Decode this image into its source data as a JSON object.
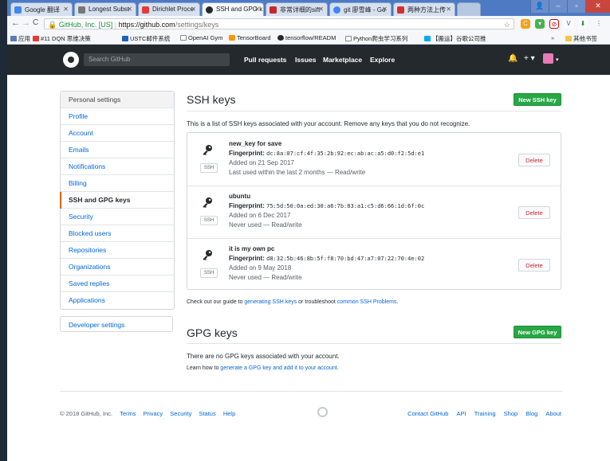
{
  "browser": {
    "tabs": [
      {
        "label": "Google 翻译",
        "color": "#4285f4"
      },
      {
        "label": "Longest Subst",
        "color": "#777777"
      },
      {
        "label": "Dirichlet Proce",
        "color": "#e53935"
      },
      {
        "label": "SSH and GPG k",
        "color": "#24292e",
        "active": true
      },
      {
        "label": "非常详细的sift",
        "color": "#c62828"
      },
      {
        "label": "git 廖雪峰 - Go",
        "color": "#4285f4"
      },
      {
        "label": "两种方法上传",
        "color": "#d32f2f"
      }
    ],
    "address": {
      "secure_label": "GitHub, Inc. [US]",
      "url_host": "https://github.com",
      "url_path": "/settings/keys"
    },
    "bookmarks": [
      {
        "label": "应用",
        "color": "#5b7ab8"
      },
      {
        "label": "#11 DQN 思维决策",
        "color": "#e53935"
      },
      {
        "label": "USTC邮件系统",
        "color": "#1565c0"
      },
      {
        "label": "OpenAI Gym",
        "color": "#888888"
      },
      {
        "label": "TensorBoard",
        "color": "#ff9800"
      },
      {
        "label": "tensorflow/READM",
        "color": "#24292e"
      },
      {
        "label": "Python爬虫学习系列",
        "color": "#888888"
      },
      {
        "label": "【搬运】谷歌公司推",
        "color": "#03a9f4"
      }
    ],
    "other_bookmarks": "其他书签"
  },
  "header": {
    "search_placeholder": "Search GitHub",
    "nav": [
      "Pull requests",
      "Issues",
      "Marketplace",
      "Explore"
    ]
  },
  "sidebar": {
    "heading": "Personal settings",
    "items": [
      "Profile",
      "Account",
      "Emails",
      "Notifications",
      "Billing",
      "SSH and GPG keys",
      "Security",
      "Blocked users",
      "Repositories",
      "Organizations",
      "Saved replies",
      "Applications"
    ],
    "selected": "SSH and GPG keys",
    "developer": "Developer settings"
  },
  "ssh": {
    "title": "SSH keys",
    "new_button": "New SSH key",
    "description": "This is a list of SSH keys associated with your account. Remove any keys that you do not recognize.",
    "badge": "SSH",
    "fingerprint_label": "Fingerprint:",
    "delete_label": "Delete",
    "keys": [
      {
        "name": "new_key for save",
        "fingerprint": "dc:8a:07:cf:4f:35:2b:92:ec:ab:ac:a5:d0:f2:5d:e1",
        "added": "Added on 21 Sep 2017",
        "usage": "Last used within the last 2 months — Read/write"
      },
      {
        "name": "ubuntu",
        "fingerprint": "75:5d:50:0a:ed:30:a6:7b:83:a1:c5:d6:66:1d:6f:0c",
        "added": "Added on 6 Dec 2017",
        "usage": "Never used — Read/write"
      },
      {
        "name": "it is my own pc",
        "fingerprint": "d8:32:5b:46:8b:5f:f8:70:bd:47:a7:07:22:70:4e:02",
        "added": "Added on 9 May 2018",
        "usage": "Never used — Read/write"
      }
    ],
    "guide_prefix": "Check out our guide to ",
    "guide_link": "generating SSH keys",
    "guide_mid": " or troubleshoot ",
    "guide_link2": "common SSH Problems",
    "guide_suffix": "."
  },
  "gpg": {
    "title": "GPG keys",
    "new_button": "New GPG key",
    "empty": "There are no GPG keys associated with your account.",
    "learn_prefix": "Learn how to ",
    "learn_link": "generate a GPG key and add it to your account",
    "learn_suffix": "."
  },
  "footer": {
    "copyright": "© 2018 GitHub, Inc.",
    "left_links": [
      "Terms",
      "Privacy",
      "Security",
      "Status",
      "Help"
    ],
    "right_links": [
      "Contact GitHub",
      "API",
      "Training",
      "Shop",
      "Blog",
      "About"
    ]
  },
  "colors": {
    "accent": "#0366d6",
    "green": "#28a745",
    "selected_bar": "#e36209",
    "danger": "#cb2431"
  }
}
